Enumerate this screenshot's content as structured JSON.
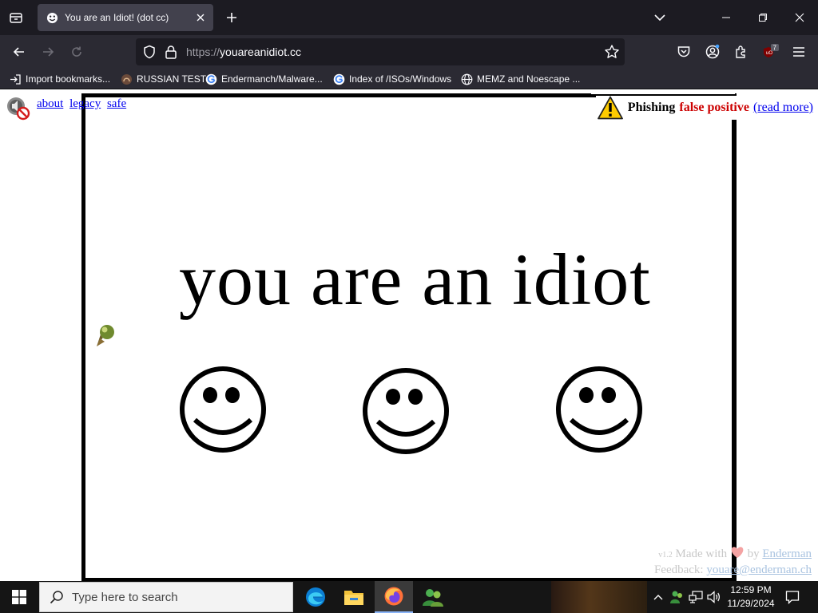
{
  "browser": {
    "tab": {
      "title": "You are an Idiot! (dot cc)"
    },
    "url": {
      "scheme": "https://",
      "host": "youareanidiot.cc"
    },
    "extension_badge": "7",
    "bookmarks": [
      {
        "label": "Import bookmarks...",
        "icon": "import-icon"
      },
      {
        "label": "RUSSIAN TEST",
        "icon": "site-icon"
      },
      {
        "label": "Endermanch/Malware...",
        "icon": "google-icon"
      },
      {
        "label": "Index of /ISOs/Windows",
        "icon": "google-icon"
      },
      {
        "label": "MEMZ and Noescape ...",
        "icon": "globe-icon"
      }
    ]
  },
  "page": {
    "links": {
      "about": "about",
      "legacy": "legacy",
      "safe": "safe"
    },
    "warning": {
      "word1": "Phishing",
      "word2": "false positive",
      "link": "(read more)"
    },
    "headline": "you are an idiot",
    "footer": {
      "version": "v1.2",
      "made_with": "Made with",
      "by": "by",
      "author": "Enderman",
      "feedback_label": "Feedback:",
      "feedback_email": "youare@enderman.ch"
    }
  },
  "taskbar": {
    "search_placeholder": "Type here to search",
    "time": "12:59 PM",
    "date": "11/29/2024"
  },
  "colors": {
    "tabstrip": "#1c1b22",
    "toolbar": "#2b2a33",
    "warning_red": "#cc0000",
    "link_blue": "#0000ee",
    "footer_grey": "#c8c8c8"
  }
}
